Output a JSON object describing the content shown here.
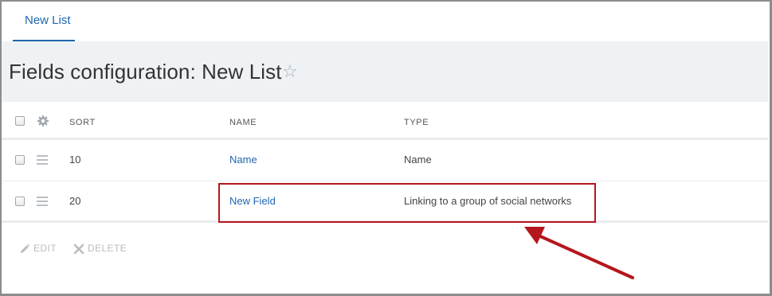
{
  "tabs": [
    {
      "label": "New List"
    }
  ],
  "page": {
    "title": "Fields configuration: New List",
    "favorite_icon": "star-outline-icon"
  },
  "table": {
    "columns": [
      "SORT",
      "NAME",
      "TYPE"
    ],
    "rows": [
      {
        "sort": "10",
        "name": "Name",
        "type": "Name"
      },
      {
        "sort": "20",
        "name": "New Field",
        "type": "Linking to a group of social networks"
      }
    ]
  },
  "actions": {
    "edit": "EDIT",
    "delete": "DELETE"
  },
  "colors": {
    "accent": "#2067b0",
    "highlight": "#b5161c",
    "header_bg": "#eef2f4"
  }
}
